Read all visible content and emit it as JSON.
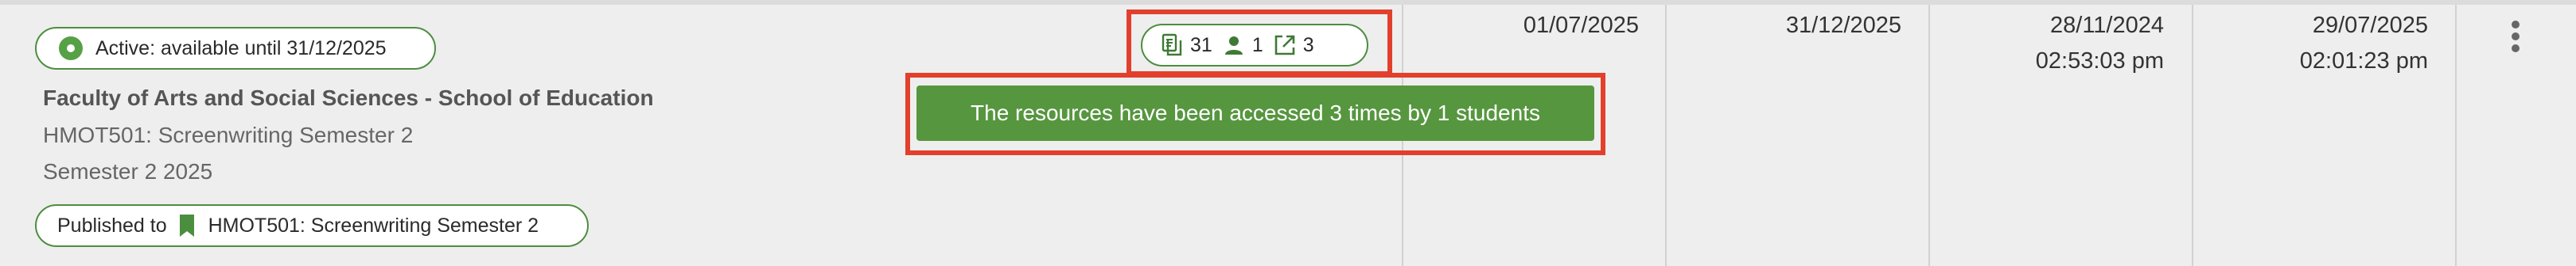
{
  "status_chip": {
    "label": "Active: available until 31/12/2025",
    "color": "#56a046"
  },
  "item": {
    "faculty": "Faculty of Arts and Social Sciences - School of Education",
    "course": "HMOT501: Screenwriting Semester 2",
    "semester": "Semester 2 2025"
  },
  "published_chip": {
    "prefix": "Published to",
    "target": "HMOT501: Screenwriting Semester 2",
    "icon": "bookmark-icon"
  },
  "stats": [
    {
      "icon": "document-icon",
      "value": "31"
    },
    {
      "icon": "person-icon",
      "value": "1"
    },
    {
      "icon": "external-link-icon",
      "value": "3"
    }
  ],
  "tooltip": {
    "text": "The resources have been accessed 3 times by 1 students"
  },
  "columns": {
    "start_date": "01/07/2025",
    "end_date": "31/12/2025",
    "created": {
      "date": "28/11/2024",
      "time": "02:53:03 pm"
    },
    "modified": {
      "date": "29/07/2025",
      "time": "02:01:23 pm"
    }
  },
  "colors": {
    "brand_green": "#56963f",
    "highlight_red": "#e2402c"
  }
}
